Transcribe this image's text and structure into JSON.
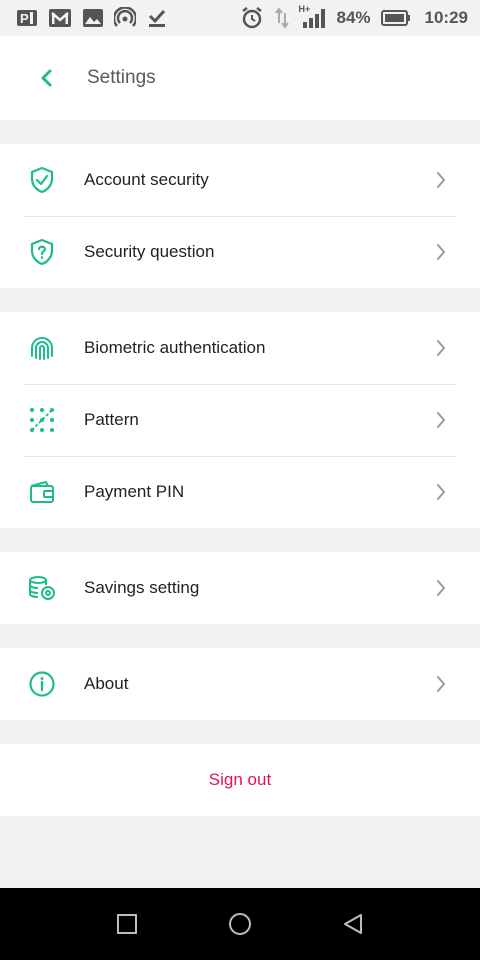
{
  "colors": {
    "accent": "#1ebc8c",
    "danger": "#e0115f",
    "chevron": "#9a9a9a"
  },
  "status_bar": {
    "battery": "84%",
    "time": "10:29",
    "network_label": "H+",
    "icons": [
      "paypal-icon",
      "gmail-icon",
      "gallery-icon",
      "hotspot-icon",
      "download-done-icon",
      "alarm-icon",
      "data-arrows-icon",
      "signal-icon",
      "battery-icon"
    ]
  },
  "header": {
    "title": "Settings",
    "back_icon": "back-chevron-icon"
  },
  "groups": [
    {
      "items": [
        {
          "label": "Account security",
          "icon": "shield-check-icon"
        },
        {
          "label": "Security question",
          "icon": "shield-question-icon"
        }
      ]
    },
    {
      "items": [
        {
          "label": "Biometric authentication",
          "icon": "fingerprint-icon"
        },
        {
          "label": "Pattern",
          "icon": "pattern-icon"
        },
        {
          "label": "Payment PIN",
          "icon": "wallet-icon"
        }
      ]
    },
    {
      "items": [
        {
          "label": "Savings setting",
          "icon": "savings-coins-icon"
        }
      ]
    },
    {
      "items": [
        {
          "label": "About",
          "icon": "info-icon"
        }
      ]
    }
  ],
  "sign_out": {
    "label": "Sign out"
  },
  "nav_bar": {
    "icons": [
      "recents-icon",
      "home-icon",
      "back-icon"
    ]
  }
}
